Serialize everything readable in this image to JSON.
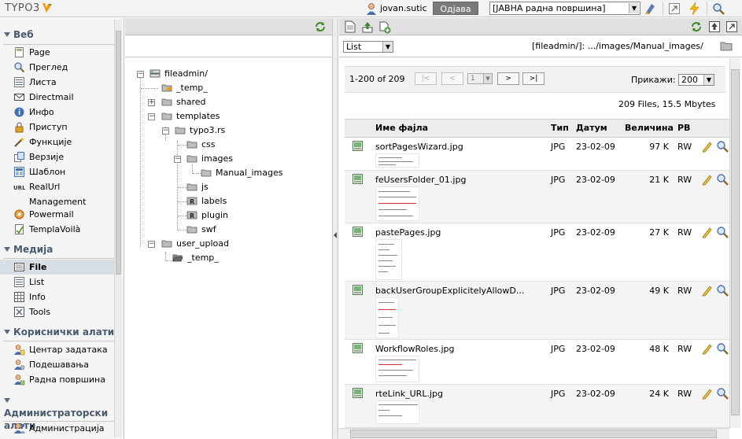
{
  "topbar": {
    "logo": "TYPO3",
    "username": "jovan.sutic",
    "logout_label": "Одјава",
    "workspace": "[ЈАВНА радна површина]"
  },
  "menu": {
    "groups": [
      {
        "title": "Веб",
        "items": [
          {
            "label": "Page",
            "icon": "page-icon"
          },
          {
            "label": "Преглед",
            "icon": "magnifier-icon"
          },
          {
            "label": "Листа",
            "icon": "list-icon"
          },
          {
            "label": "Directmail",
            "icon": "envelope-icon"
          },
          {
            "label": "Инфо",
            "icon": "info-icon"
          },
          {
            "label": "Приступ",
            "icon": "lock-icon"
          },
          {
            "label": "Функције",
            "icon": "wand-icon"
          },
          {
            "label": "Верзије",
            "icon": "versions-icon"
          },
          {
            "label": "Шаблон",
            "icon": "template-icon"
          },
          {
            "label": "RealUrl Management",
            "icon": "url-icon"
          },
          {
            "label": "Powermail",
            "icon": "powermail-icon"
          },
          {
            "label": "TemplaVoilà",
            "icon": "templavoila-icon"
          }
        ]
      },
      {
        "title": "Медија",
        "items": [
          {
            "label": "File",
            "icon": "file-icon",
            "active": true
          },
          {
            "label": "List",
            "icon": "list-icon"
          },
          {
            "label": "Info",
            "icon": "info-table-icon"
          },
          {
            "label": "Tools",
            "icon": "tools-icon"
          }
        ]
      },
      {
        "title": "Кориснички алати",
        "items": [
          {
            "label": "Центар задатака",
            "icon": "user-task-icon"
          },
          {
            "label": "Подешавања",
            "icon": "user-settings-icon"
          },
          {
            "label": "Радна површина",
            "icon": "workspace-icon"
          }
        ]
      },
      {
        "title": "Администраторски алати",
        "items": [
          {
            "label": "Администрација",
            "icon": "admin-icon"
          }
        ]
      }
    ]
  },
  "tree": {
    "nodes": [
      {
        "label": "fileadmin/",
        "icon": "server-icon"
      },
      {
        "label": "_temp_",
        "icon": "locked-folder-icon"
      },
      {
        "label": "shared",
        "icon": "folder-icon"
      },
      {
        "label": "templates",
        "icon": "folder-icon"
      },
      {
        "label": "typo3.rs",
        "icon": "folder-icon"
      },
      {
        "label": "css",
        "icon": "folder-icon"
      },
      {
        "label": "images",
        "icon": "folder-icon"
      },
      {
        "label": "Manual_images",
        "icon": "folder-icon"
      },
      {
        "label": "js",
        "icon": "folder-icon"
      },
      {
        "label": "labels",
        "icon": "r-folder-icon"
      },
      {
        "label": "plugin",
        "icon": "r-folder-icon"
      },
      {
        "label": "swf",
        "icon": "folder-icon"
      },
      {
        "label": "user_upload",
        "icon": "folder-icon"
      },
      {
        "label": "_temp_",
        "icon": "open-folder-icon"
      }
    ]
  },
  "filelist": {
    "view_mode": "List",
    "path": "[fileadmin/]: .../images/Manual_images/",
    "range": "1-200 of 209",
    "page": "1",
    "pager": {
      "first": "|<",
      "prev": "<",
      "next": ">",
      "last": ">|"
    },
    "show_label": "Прикажи:",
    "show_value": "200",
    "summary": "209 Files, 15.5 Mbytes",
    "columns": {
      "name": "Име фајла",
      "type": "Тип",
      "date": "Датум",
      "size": "Величина",
      "rights": "РВ"
    },
    "rows": [
      {
        "name": "sortPagesWizard.jpg",
        "type": "JPG",
        "date": "23-02-09",
        "size": "97 K",
        "rights": "RW"
      },
      {
        "name": "feUsersFolder_01.jpg",
        "type": "JPG",
        "date": "23-02-09",
        "size": "21 K",
        "rights": "RW"
      },
      {
        "name": "pastePages.jpg",
        "type": "JPG",
        "date": "23-02-09",
        "size": "27 K",
        "rights": "RW"
      },
      {
        "name": "backUserGroupExplicitelyAllowD...",
        "type": "JPG",
        "date": "23-02-09",
        "size": "49 K",
        "rights": "RW"
      },
      {
        "name": "WorkflowRoles.jpg",
        "type": "JPG",
        "date": "23-02-09",
        "size": "48 K",
        "rights": "RW"
      },
      {
        "name": "rteLink_URL.jpg",
        "type": "JPG",
        "date": "23-02-09",
        "size": "24 K",
        "rights": "RW"
      }
    ]
  }
}
